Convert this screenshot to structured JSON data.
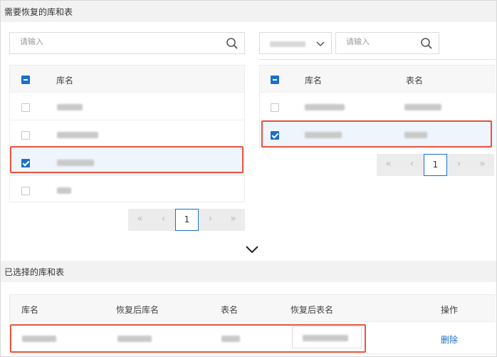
{
  "restore_section": {
    "title": "需要恢复的库和表"
  },
  "left_panel": {
    "search_placeholder": "请输入",
    "header": {
      "db_name": "库名"
    },
    "rows": [
      {
        "checked": false
      },
      {
        "checked": false
      },
      {
        "checked": true
      },
      {
        "checked": false
      }
    ],
    "pager": {
      "first": "«",
      "prev": "‹",
      "page": "1",
      "next": "›",
      "last": "»"
    }
  },
  "right_panel": {
    "search_placeholder": "请输入",
    "header": {
      "db_name": "库名",
      "table_name": "表名"
    },
    "rows": [
      {
        "checked": false
      },
      {
        "checked": true
      }
    ],
    "pager": {
      "first": "«",
      "prev": "‹",
      "page": "1",
      "next": "›",
      "last": "»"
    }
  },
  "selected_section": {
    "title": "已选择的库和表",
    "header": {
      "db_name": "库名",
      "restored_db_name": "恢复后库名",
      "table_name": "表名",
      "restored_table_name": "恢复后表名",
      "action": "操作"
    },
    "rows": [
      {
        "action_label": "删除"
      }
    ]
  },
  "colors": {
    "accent": "#1a6fc9",
    "highlight": "#e8553e",
    "section_bg": "#f2f2f2"
  }
}
